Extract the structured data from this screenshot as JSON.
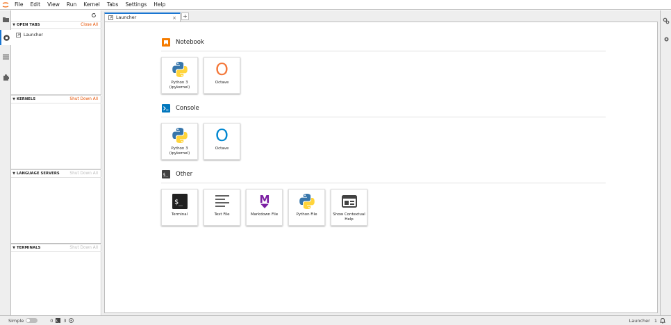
{
  "menu": [
    "File",
    "Edit",
    "View",
    "Run",
    "Kernel",
    "Tabs",
    "Settings",
    "Help"
  ],
  "sidebar": {
    "sections": [
      {
        "title": "OPEN TABS",
        "action": "Close All",
        "action_enabled": true,
        "items": [
          "Launcher"
        ]
      },
      {
        "title": "KERNELS",
        "action": "Shut Down All",
        "action_enabled": true
      },
      {
        "title": "LANGUAGE SERVERS",
        "action": "Shut Down All",
        "action_enabled": false
      },
      {
        "title": "TERMINALS",
        "action": "Shut Down All",
        "action_enabled": false
      }
    ]
  },
  "tabs": [
    {
      "label": "Launcher",
      "active": true
    }
  ],
  "add_tab_label": "+",
  "launcher": {
    "categories": [
      {
        "title": "Notebook",
        "icon": "notebook-icon",
        "color": "#f57c00",
        "items": [
          {
            "label": "Python 3 (ipykernel)",
            "icon": "python-icon"
          },
          {
            "label": "Octave",
            "icon": "octave-icon",
            "glyph": "O",
            "color": "#f4783a"
          }
        ]
      },
      {
        "title": "Console",
        "icon": "console-icon",
        "color": "#0277bd",
        "items": [
          {
            "label": "Python 3 (ipykernel)",
            "icon": "python-icon"
          },
          {
            "label": "Octave",
            "icon": "octave-icon",
            "glyph": "O",
            "color": "#0288d1"
          }
        ]
      },
      {
        "title": "Other",
        "icon": "terminal-prompt-icon",
        "color": "#424242",
        "items": [
          {
            "label": "Terminal",
            "icon": "terminal-icon"
          },
          {
            "label": "Text File",
            "icon": "text-file-icon"
          },
          {
            "label": "Markdown File",
            "icon": "markdown-icon",
            "glyph": "M",
            "color": "#7b1fa2"
          },
          {
            "label": "Python File",
            "icon": "python-icon"
          },
          {
            "label": "Show Contextual Help",
            "icon": "contextual-help-icon"
          }
        ]
      }
    ]
  },
  "statusbar": {
    "mode_label": "Simple",
    "simple_mode": false,
    "kernels_count": "0",
    "terminals_count": "3",
    "active_label": "Launcher",
    "notifications_count": "1"
  },
  "colors": {
    "accent": "#1976d2",
    "action": "#e65100",
    "python_blue": "#3776ab",
    "python_yellow": "#ffd43b"
  }
}
